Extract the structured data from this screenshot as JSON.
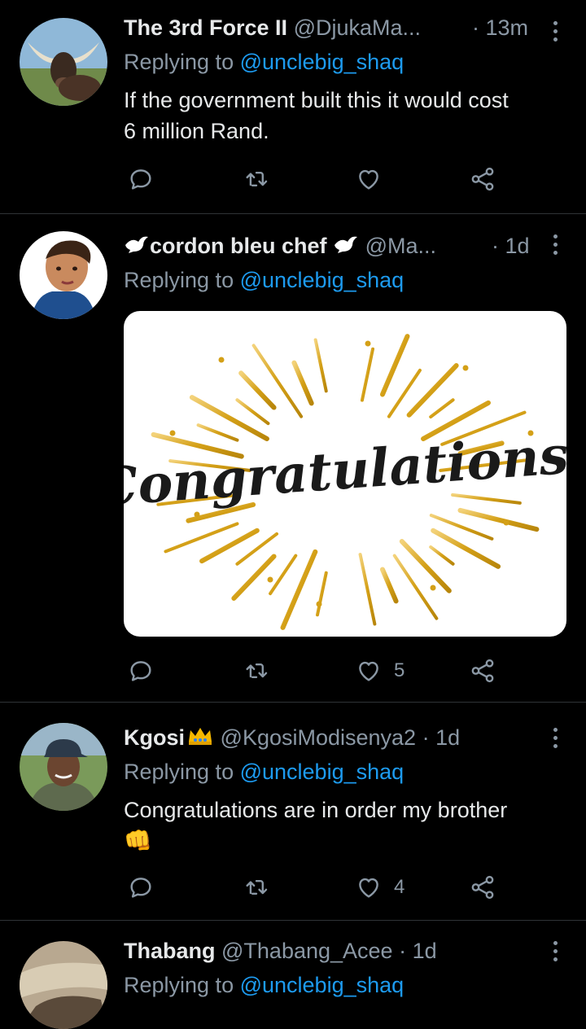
{
  "tweets": [
    {
      "name": "The 3rd Force II",
      "handle": "@DjukaMa...",
      "dot": "·",
      "time": "13m",
      "reply_prefix": "Replying to ",
      "reply_to": "@unclebig_shaq",
      "text_line1": "If the government built this it would cost",
      "text_line2": "6 million Rand.",
      "likes": ""
    },
    {
      "name_prefix_icon": "dove-icon",
      "name": "cordon bleu chef",
      "name_suffix_icon": "dove-icon",
      "handle": "@Ma...",
      "dot": "·",
      "time": "1d",
      "reply_prefix": "Replying to ",
      "reply_to": "@unclebig_shaq",
      "media_text": "Congratulations!",
      "likes": "5"
    },
    {
      "name": "Kgosi",
      "name_suffix_icon": "crown-icon",
      "handle": "@KgosiModisenya2",
      "dot": "·",
      "time": "1d",
      "reply_prefix": "Replying to ",
      "reply_to": "@unclebig_shaq",
      "text_line1": "Congratulations are in order my brother",
      "emoji": "👊",
      "likes": "4"
    },
    {
      "name": "Thabang",
      "handle": "@Thabang_Acee",
      "dot": "·",
      "time": "1d",
      "reply_prefix": "Replying to ",
      "reply_to": "@unclebig_shaq"
    }
  ],
  "colors": {
    "background": "#000000",
    "text": "#e7e9ea",
    "muted": "#8b98a5",
    "link": "#1d9bf0",
    "divider": "#2f3336",
    "gold": "#d4a017"
  }
}
